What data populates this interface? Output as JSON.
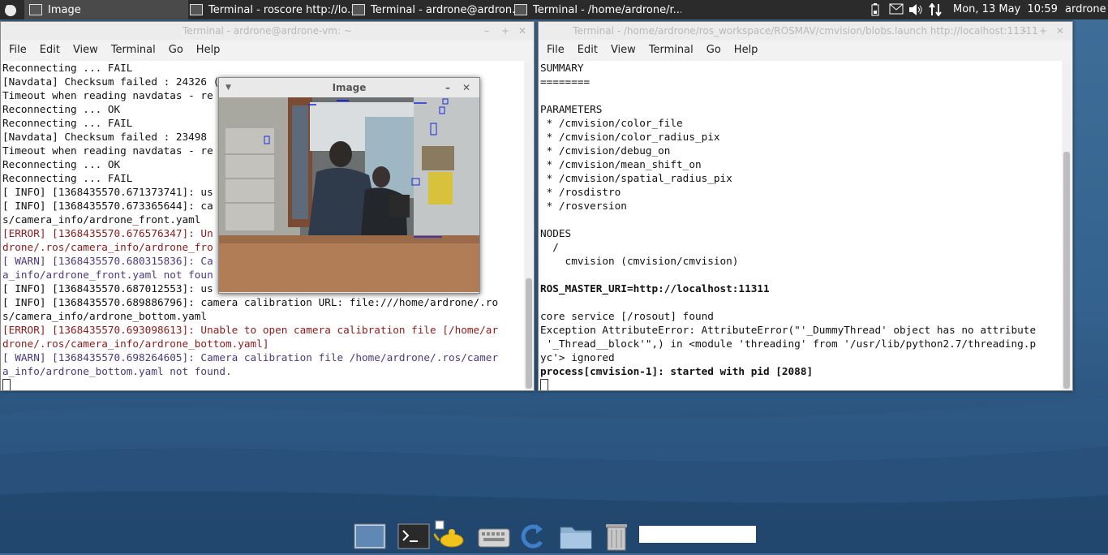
{
  "top_panel": {
    "tasks": [
      {
        "label": "Image",
        "active": true
      },
      {
        "label": "Terminal - roscore http://lo..."
      },
      {
        "label": "Terminal - ardrone@ardron..."
      },
      {
        "label": "Terminal - /home/ardrone/r..."
      }
    ],
    "clock": "Mon, 13 May  10:59",
    "user": "ardrone"
  },
  "left_terminal": {
    "title": "Terminal - ardrone@ardrone-vm: ~",
    "menu": [
      "File",
      "Edit",
      "View",
      "Terminal",
      "Go",
      "Help"
    ],
    "lines": [
      {
        "text": "Reconnecting ... FAIL",
        "type": "normal"
      },
      {
        "text": "[Navdata] Checksum failed : 24326 (distant) / 24300 (local)",
        "type": "normal"
      },
      {
        "text": "Timeout when reading navdatas - re",
        "type": "normal"
      },
      {
        "text": "Reconnecting ... OK",
        "type": "normal"
      },
      {
        "text": "Reconnecting ... FAIL",
        "type": "normal"
      },
      {
        "text": "[Navdata] Checksum failed : 23498",
        "type": "normal"
      },
      {
        "text": "Timeout when reading navdatas - re",
        "type": "normal"
      },
      {
        "text": "Reconnecting ... OK",
        "type": "normal"
      },
      {
        "text": "Reconnecting ... FAIL",
        "type": "normal"
      },
      {
        "text": "[ INFO] [1368435570.671373741]: us",
        "type": "normal"
      },
      {
        "text": "[ INFO] [1368435570.673365644]: ca                                one/.ro",
        "type": "normal"
      },
      {
        "text": "s/camera_info/ardrone_front.yaml",
        "type": "normal"
      },
      {
        "text": "[ERROR] [1368435570.676576347]: Un                                /home/ar",
        "type": "err"
      },
      {
        "text": "drone/.ros/camera_info/ardrone_fro",
        "type": "err"
      },
      {
        "text": "[ WARN] [1368435570.680315836]: Ca                                 s/camer",
        "type": "warn"
      },
      {
        "text": "a_info/ardrone_front.yaml not foun",
        "type": "warn"
      },
      {
        "text": "[ INFO] [1368435570.687012553]: us",
        "type": "normal"
      },
      {
        "text": "[ INFO] [1368435570.689886796]: camera calibration URL: file:///home/ardrone/.ro",
        "type": "normal"
      },
      {
        "text": "s/camera_info/ardrone_bottom.yaml",
        "type": "normal"
      },
      {
        "text": "[ERROR] [1368435570.693098613]: Unable to open camera calibration file [/home/ar",
        "type": "err"
      },
      {
        "text": "drone/.ros/camera_info/ardrone_bottom.yaml]",
        "type": "err"
      },
      {
        "text": "[ WARN] [1368435570.698264605]: Camera calibration file /home/ardrone/.ros/camer",
        "type": "warn"
      },
      {
        "text": "a_info/ardrone_bottom.yaml not found.",
        "type": "warn"
      }
    ]
  },
  "right_terminal": {
    "title": "Terminal - /home/ardrone/ros_workspace/ROSMAV/cmvision/blobs.launch http://localhost:11311",
    "menu": [
      "File",
      "Edit",
      "View",
      "Terminal",
      "Go",
      "Help"
    ],
    "lines": [
      {
        "text": "SUMMARY",
        "type": "normal"
      },
      {
        "text": "========",
        "type": "normal"
      },
      {
        "text": "",
        "type": "normal"
      },
      {
        "text": "PARAMETERS",
        "type": "normal"
      },
      {
        "text": " * /cmvision/color_file",
        "type": "normal"
      },
      {
        "text": " * /cmvision/color_radius_pix",
        "type": "normal"
      },
      {
        "text": " * /cmvision/debug_on",
        "type": "normal"
      },
      {
        "text": " * /cmvision/mean_shift_on",
        "type": "normal"
      },
      {
        "text": " * /cmvision/spatial_radius_pix",
        "type": "normal"
      },
      {
        "text": " * /rosdistro",
        "type": "normal"
      },
      {
        "text": " * /rosversion",
        "type": "normal"
      },
      {
        "text": "",
        "type": "normal"
      },
      {
        "text": "NODES",
        "type": "normal"
      },
      {
        "text": "  /",
        "type": "normal"
      },
      {
        "text": "    cmvision (cmvision/cmvision)",
        "type": "normal"
      },
      {
        "text": "",
        "type": "normal"
      },
      {
        "text": "ROS_MASTER_URI=http://localhost:11311",
        "type": "bold"
      },
      {
        "text": "",
        "type": "normal"
      },
      {
        "text": "core service [/rosout] found",
        "type": "normal"
      },
      {
        "text": "Exception AttributeError: AttributeError(\"'_DummyThread' object has no attribute",
        "type": "normal"
      },
      {
        "text": " '_Thread__block'\",) in <module 'threading' from '/usr/lib/python2.7/threading.p",
        "type": "normal"
      },
      {
        "text": "yc'> ignored",
        "type": "normal"
      },
      {
        "text": "process[cmvision-1]: started with pid [2088]",
        "type": "bold"
      }
    ]
  },
  "image_window": {
    "title": "Image"
  },
  "dock": {
    "items": [
      "desktop-icon",
      "terminal-icon",
      "genie-lamp-icon",
      "keyboard-icon",
      "refresh-icon",
      "folder-icon",
      "trash-icon"
    ]
  }
}
